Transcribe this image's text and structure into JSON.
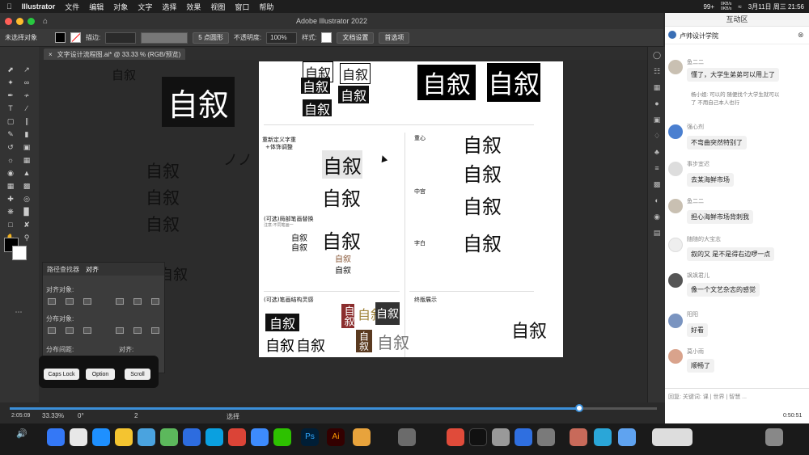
{
  "menubar": {
    "app": "Illustrator",
    "items": [
      "文件",
      "编辑",
      "对象",
      "文字",
      "选择",
      "效果",
      "视图",
      "窗口",
      "帮助"
    ],
    "tray_badge": "99+",
    "net_up": "0KB/s",
    "net_down": "0KB/s",
    "clock": "3月11日 周三 21:56"
  },
  "window": {
    "title": "Adobe Illustrator 2022",
    "chat_title": "互动区"
  },
  "control_bar": {
    "selection": "未选择对象",
    "stroke_label": "描边:",
    "brush": "5 点圆形",
    "opacity_label": "不透明度:",
    "opacity_value": "100%",
    "style_label": "样式:",
    "doc_setup": "文档设置",
    "prefs": "首选项"
  },
  "doc_tab": {
    "name": "文字设计流程图.ai* @ 33.33 % (RGB/预览)",
    "close": "×"
  },
  "canvas": {
    "glyph": "自叙",
    "left_labels": [
      "自叙",
      "自叙",
      "自叙",
      "自叙",
      "自叙"
    ],
    "stray": "ノノ"
  },
  "artboard": {
    "sec_redefine": "重新定义字重",
    "sec_redefine2": "+体饰调整",
    "sec_center": "重心",
    "sec_palace": "中宫",
    "sec_white": "字白",
    "sec_stroke_replace": "(可选)局部笔画替换",
    "sec_stroke_replace_sub": "注意:不同笔画一",
    "sec_structure": "(可选)笔画结构灵感",
    "sec_final": "终版展示"
  },
  "align_panel": {
    "tabs": [
      "路径查找器",
      "对齐"
    ],
    "align_objects": "对齐对象:",
    "distribute_objects": "分布对象:",
    "distribute_spacing": "分布间距:",
    "align_to": "对齐:"
  },
  "keyboard": {
    "keys": [
      "Caps Lock",
      "Option",
      "Scroll"
    ]
  },
  "status": {
    "zoom": "33.33%",
    "rotate": "0°",
    "page": "2",
    "mode": "选择",
    "time_left": "2:05:09",
    "time_right": "0:50:51",
    "progress": 0.88
  },
  "chat": {
    "host": "卢帅设计学院",
    "input_hint": "回复: 关键词: 课 | 世界 | 智慧 ...",
    "messages": [
      {
        "user": "鱼二二",
        "text": "懂了，大学生弟弟可以用上了"
      },
      {
        "user": "",
        "text": "杨小姐: 可以的 随便找个大学生就可以了 不用自己本人也行"
      },
      {
        "user": "强心剂",
        "text": "不弯曲突然特别了"
      },
      {
        "user": "事步宜迟",
        "text": "去某海鲜市场"
      },
      {
        "user": "鱼二二",
        "text": "担心海鲜市场背刺我"
      },
      {
        "user": "随随的大宝志",
        "text": "叙的又 是不是得右边啰一点"
      },
      {
        "user": "飒飒君儿",
        "text": "像一个文艺杂志的感觉"
      },
      {
        "user": "阳阳",
        "text": "好看"
      },
      {
        "user": "莫小雨",
        "text": "顺畅了"
      }
    ]
  },
  "colors": {
    "accent": "#3b8fd9",
    "chat_bg": "#ffffff",
    "ui_dark": "#2b2b2b"
  }
}
